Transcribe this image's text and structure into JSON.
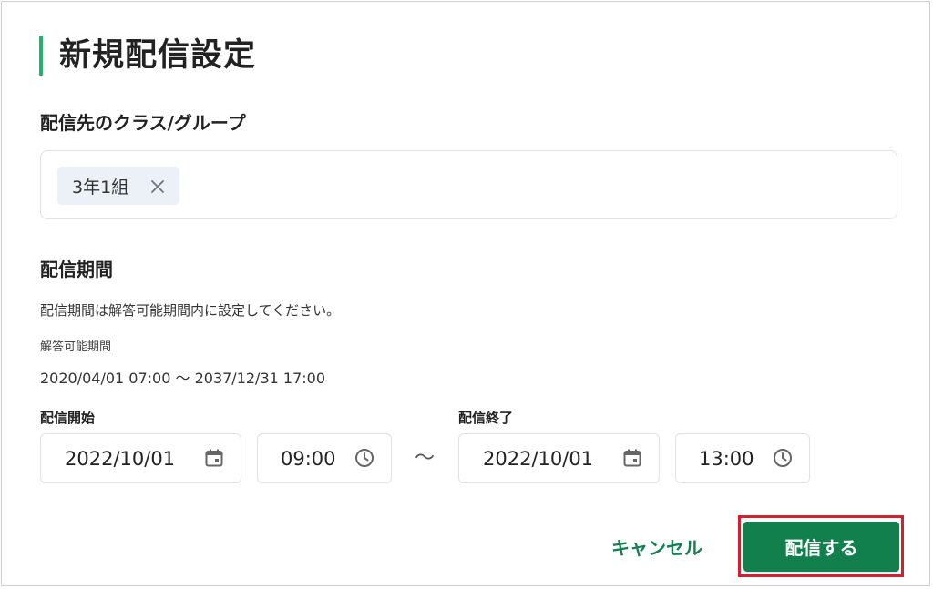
{
  "page": {
    "title": "新規配信設定",
    "accent_color": "#23b26b",
    "primary_color": "#11804d",
    "highlight_color": "#d4202e"
  },
  "target": {
    "label": "配信先のクラス/グループ",
    "chips": [
      {
        "label": "3年1組",
        "icon": "close-icon"
      }
    ]
  },
  "period": {
    "label": "配信期間",
    "note": "配信期間は解答可能期間内に設定してください。",
    "answer_period_label": "解答可能期間",
    "answer_period_range": "2020/04/01 07:00 〜 2037/12/31 17:00",
    "separator": "〜",
    "start": {
      "label": "配信開始",
      "date": "2022/10/01",
      "time": "09:00",
      "date_icon": "calendar-icon",
      "time_icon": "clock-icon"
    },
    "end": {
      "label": "配信終了",
      "date": "2022/10/01",
      "time": "13:00",
      "date_icon": "calendar-icon",
      "time_icon": "clock-icon"
    }
  },
  "actions": {
    "cancel_label": "キャンセル",
    "submit_label": "配信する"
  }
}
